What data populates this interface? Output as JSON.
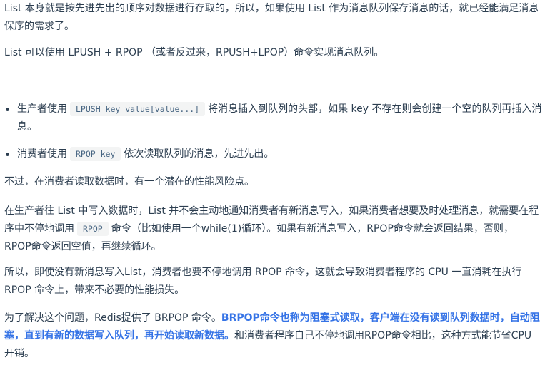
{
  "p1": "List 本身就是按先进先出的顺序对数据进行存取的，所以，如果使用 List 作为消息队列保存消息的话，就已经能满足消息保序的需求了。",
  "p2": "List 可以使用 LPUSH + RPOP （或者反过来，RPUSH+LPOP）命令实现消息队列。",
  "bullets": [
    {
      "pre": "生产者使用",
      "code": "LPUSH key value[value...]",
      "post": "将消息插入到队列的头部，如果 key 不存在则会创建一个空的队列再插入消息。"
    },
    {
      "pre": "消费者使用",
      "code": "RPOP key",
      "post": "依次读取队列的消息，先进先出。"
    }
  ],
  "p3": "不过，在消费者读取数据时，有一个潜在的性能风险点。",
  "p4": {
    "pre": "在生产者往 List 中写入数据时，List 并不会主动地通知消费者有新消息写入，如果消费者想要及时处理消息，就需要在程序中不停地调用",
    "code": "RPOP",
    "post": "命令（比如使用一个while(1)循环）。如果有新消息写入，RPOP命令就会返回结果，否则，RPOP命令返回空值，再继续循环。"
  },
  "p5": "所以，即使没有新消息写入List，消费者也要不停地调用 RPOP 命令，这就会导致消费者程序的 CPU 一直消耗在执行 RPOP 命令上，带来不必要的性能损失。",
  "p6": {
    "pre": "为了解决这个问题，Redis提供了 BRPOP 命令。",
    "bold": "BRPOP命令也称为阻塞式读取，客户端在没有读到队列数据时，自动阻塞，直到有新的数据写入队列，再开始读取新数据。",
    "post": "和消费者程序自己不停地调用RPOP命令相比，这种方式能节省CPU开销。"
  }
}
